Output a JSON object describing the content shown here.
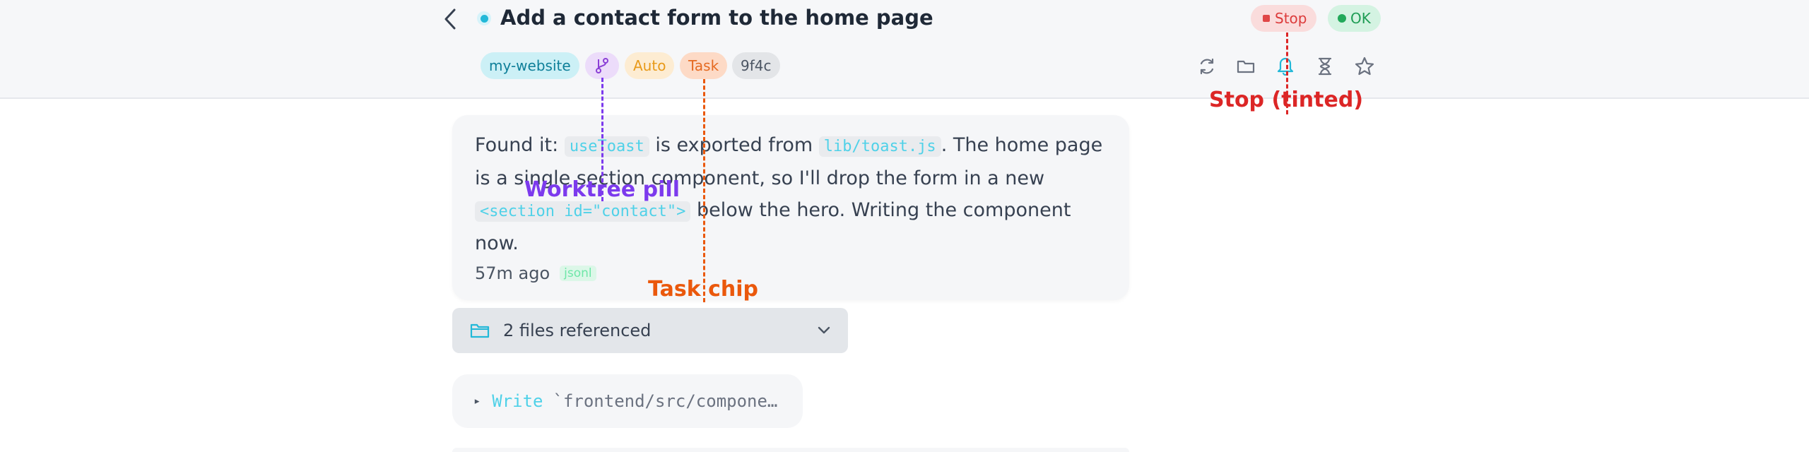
{
  "header": {
    "title": "Add a contact form to the home page",
    "back_label": "‹",
    "status_color": "#22b8d8",
    "badges": {
      "stop": "Stop",
      "ok": "OK"
    },
    "pills": {
      "repo": "my-website",
      "mode": "Auto",
      "kind": "Task",
      "hash": "9f4c"
    },
    "toolbar_icons": [
      "refresh-icon",
      "folder-icon",
      "bell-icon",
      "hourglass-icon",
      "star-icon"
    ]
  },
  "message": {
    "seg1": "Found it: ",
    "code1": "useToast",
    "seg2": " is exported from ",
    "code2": "lib/toast.js",
    "seg3": ". The home page is a single section component, so I'll drop the form in a new ",
    "code3": "<section id=\"contact\">",
    "seg4": " below the hero. Writing the component now.",
    "time": "57m ago",
    "format": "jsonl"
  },
  "files": {
    "label": "2 files referenced"
  },
  "tool_call": {
    "arrow": "▸",
    "name": "Write",
    "arg": "`frontend/src/compone…"
  },
  "annotations": {
    "stop": "Stop (tinted)",
    "worktree": "Worktree pill",
    "task": "Task chip"
  },
  "colors": {
    "stop": "#dc2626",
    "worktree": "#7c3aed",
    "task": "#ea580c",
    "accent": "#22b8d8"
  }
}
